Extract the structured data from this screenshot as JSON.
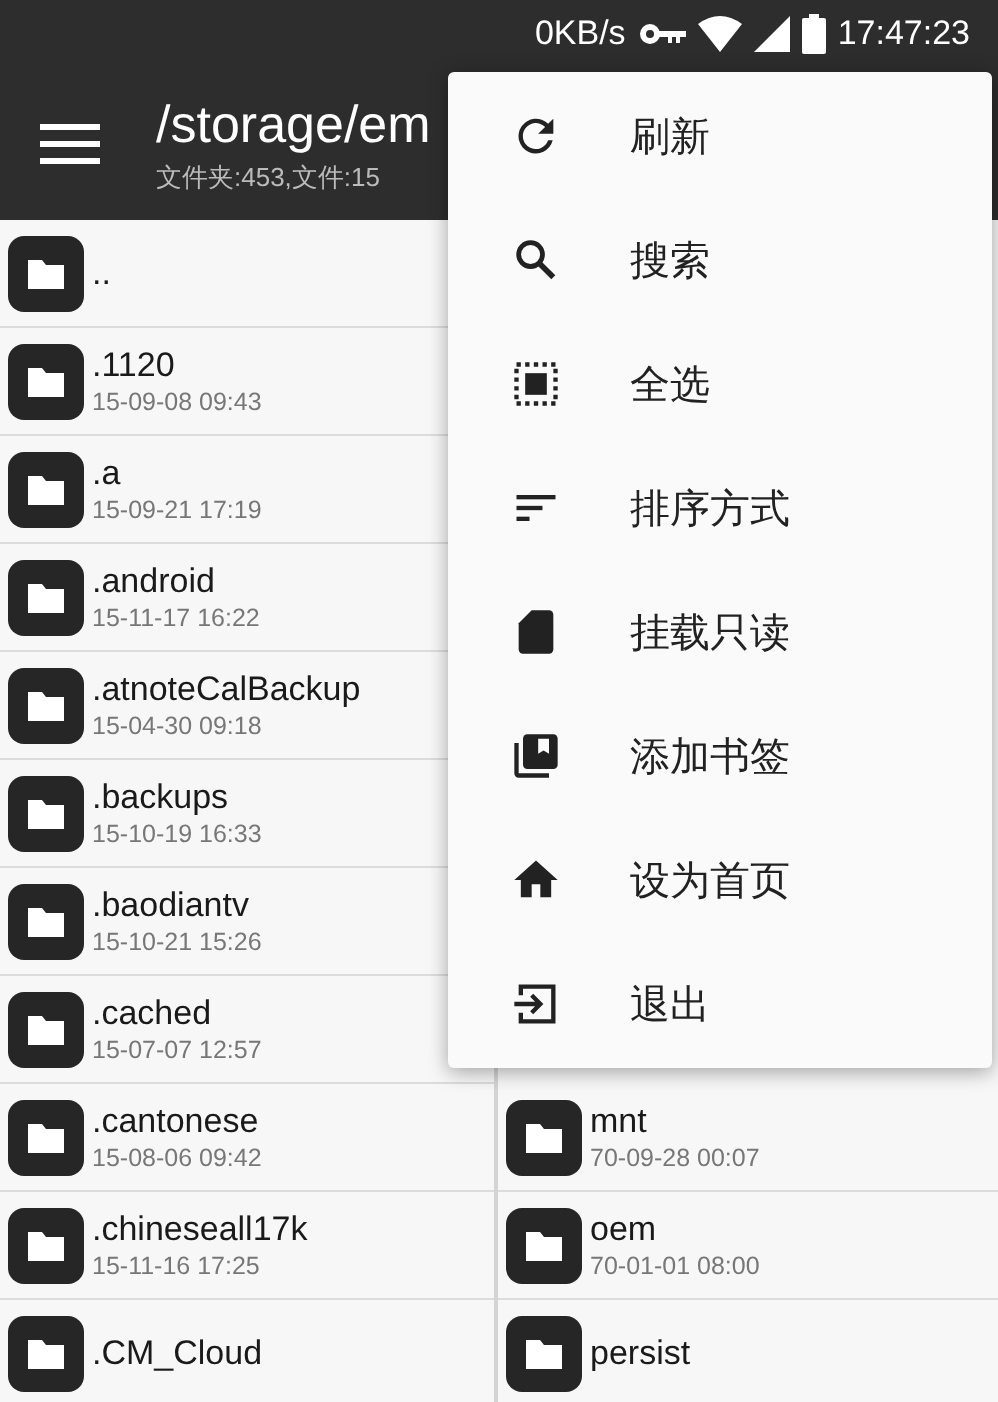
{
  "status_bar": {
    "speed": "0KB/s",
    "time": "17:47:23"
  },
  "app_bar": {
    "title": "/storage/em",
    "subtitle": "文件夹:453,文件:15"
  },
  "left_column": [
    {
      "name": ".."
    },
    {
      "name": ".1120",
      "date": "15-09-08 09:43"
    },
    {
      "name": ".a",
      "date": "15-09-21 17:19"
    },
    {
      "name": ".android",
      "date": "15-11-17 16:22"
    },
    {
      "name": ".atnoteCalBackup",
      "date": "15-04-30 09:18"
    },
    {
      "name": ".backups",
      "date": "15-10-19 16:33"
    },
    {
      "name": ".baodiantv",
      "date": "15-10-21 15:26"
    },
    {
      "name": ".cached",
      "date": "15-07-07 12:57"
    },
    {
      "name": ".cantonese",
      "date": "15-08-06 09:42"
    },
    {
      "name": ".chineseall17k",
      "date": "15-11-16 17:25"
    },
    {
      "name": ".CM_Cloud"
    }
  ],
  "right_column": [
    {
      "name": "mnt",
      "date": "70-09-28 00:07"
    },
    {
      "name": "oem",
      "date": "70-01-01 08:00"
    },
    {
      "name": "persist"
    }
  ],
  "menu": [
    {
      "label": "刷新"
    },
    {
      "label": "搜索"
    },
    {
      "label": "全选"
    },
    {
      "label": "排序方式"
    },
    {
      "label": "挂载只读"
    },
    {
      "label": "添加书签"
    },
    {
      "label": "设为首页"
    },
    {
      "label": "退出"
    }
  ]
}
